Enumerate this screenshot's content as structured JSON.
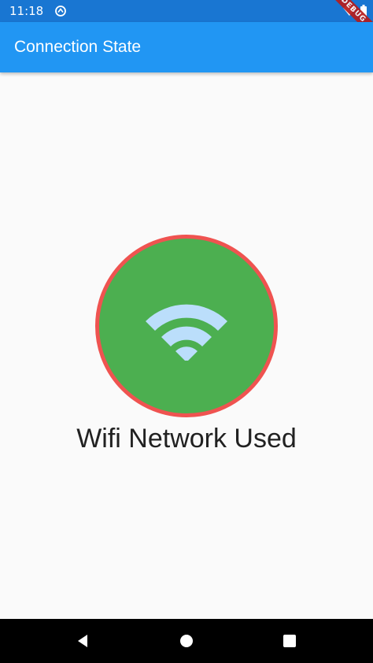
{
  "status_bar": {
    "time": "11:18",
    "icons": [
      "sync-icon",
      "wifi-signal-icon",
      "battery-icon"
    ]
  },
  "debug_banner": "DEBUG",
  "app_bar": {
    "title": "Connection State",
    "color": "#2196f3"
  },
  "main": {
    "indicator_icon": "wifi-icon",
    "indicator_color": "#4caf50",
    "indicator_border_color": "#ef5350",
    "label": "Wifi Network Used"
  },
  "nav_bar": {
    "buttons": [
      "back-icon",
      "home-icon",
      "recents-icon"
    ]
  }
}
